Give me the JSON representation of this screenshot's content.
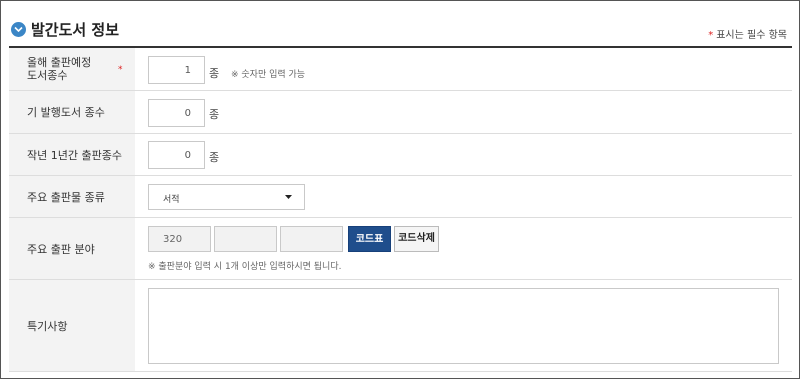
{
  "header": {
    "title": "발간도서 정보",
    "required_star": "*",
    "required_note": "표시는 필수 항목"
  },
  "rows": {
    "planned": {
      "label_line1": "올해 출판예정",
      "label_line2": "도서종수",
      "required_star": "*",
      "value": "1",
      "unit": "종",
      "hint": "※ 숫자만 입력 가능"
    },
    "published": {
      "label": "기 발행도서 종수",
      "value": "0",
      "unit": "종"
    },
    "last_year": {
      "label": "작년 1년간 출판종수",
      "value": "0",
      "unit": "종"
    },
    "type": {
      "label": "주요 출판물 종류",
      "selected": "서적"
    },
    "field": {
      "label": "주요 출판 분야",
      "codes": [
        "320",
        "",
        ""
      ],
      "code_table_button": "코드표",
      "code_delete_button": "코드삭제",
      "hint": "※ 출판분야 입력 시 1개 이상만 입력하시면 됩니다."
    },
    "notes": {
      "label": "특기사항",
      "value": ""
    }
  },
  "colors": {
    "title_icon": "#3b86c6",
    "required_star": "#dd2222",
    "primary_button": "#1f4e8c",
    "label_background": "#f3f3f3"
  },
  "icons": {
    "title_icon": "chevron-down-circle-icon",
    "select_caret": "caret-down-icon"
  }
}
